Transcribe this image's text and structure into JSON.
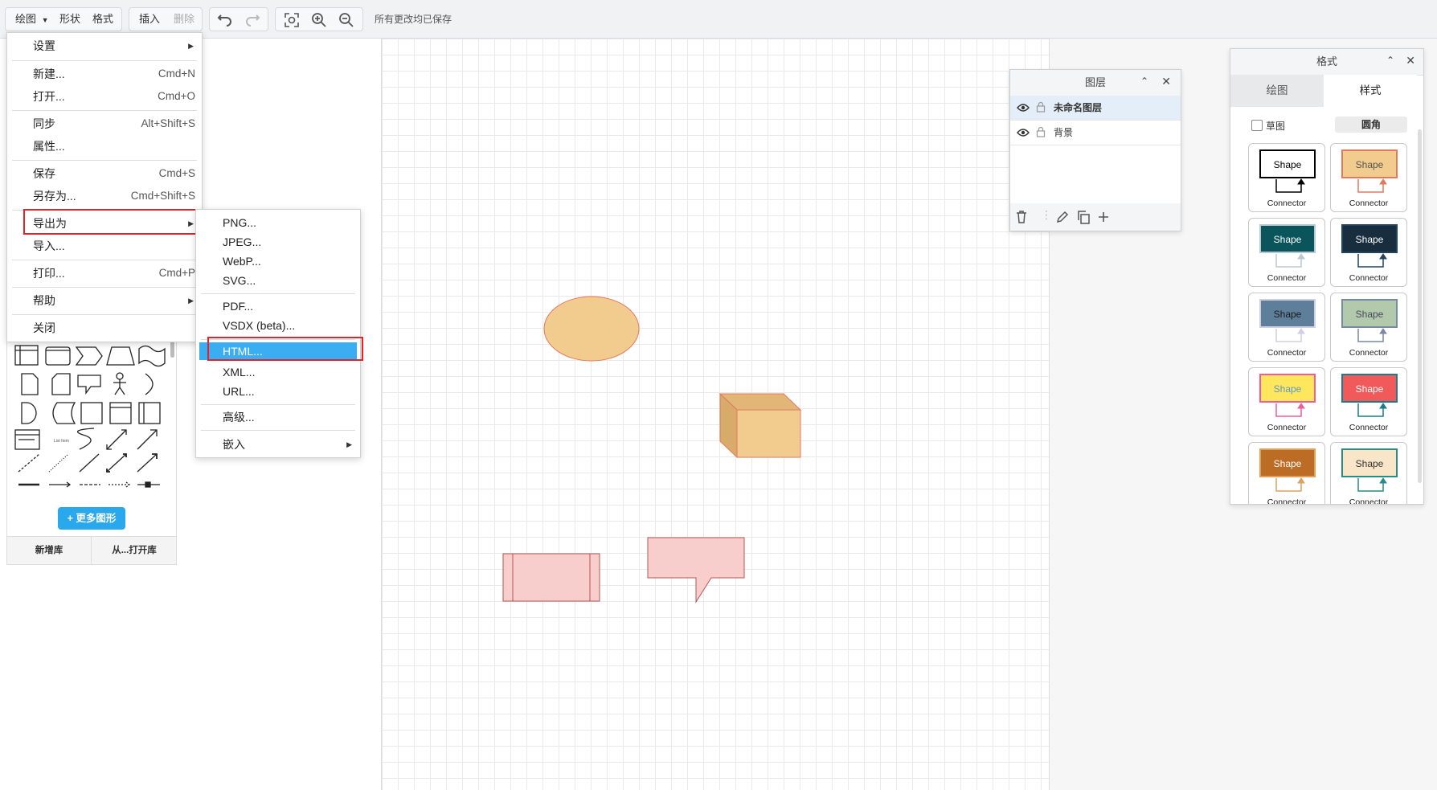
{
  "toolbar": {
    "draw_menu": "绘图",
    "shape_menu": "形状",
    "format_menu": "格式",
    "insert": "插入",
    "delete": "删除",
    "status": "所有更改均已保存"
  },
  "draw_menu": {
    "items": [
      {
        "label": "设置",
        "shortcut": ""
      },
      {
        "label": "新建...",
        "shortcut": "Cmd+N"
      },
      {
        "label": "打开...",
        "shortcut": "Cmd+O"
      },
      {
        "label": "同步",
        "shortcut": "Alt+Shift+S"
      },
      {
        "label": "属性...",
        "shortcut": ""
      },
      {
        "label": "保存",
        "shortcut": "Cmd+S"
      },
      {
        "label": "另存为...",
        "shortcut": "Cmd+Shift+S"
      },
      {
        "label": "导出为",
        "shortcut": ""
      },
      {
        "label": "导入...",
        "shortcut": ""
      },
      {
        "label": "打印...",
        "shortcut": "Cmd+P"
      },
      {
        "label": "帮助",
        "shortcut": ""
      },
      {
        "label": "关闭",
        "shortcut": ""
      }
    ]
  },
  "export_menu": {
    "items": [
      "PNG...",
      "JPEG...",
      "WebP...",
      "SVG...",
      "PDF...",
      "VSDX (beta)...",
      "HTML...",
      "XML...",
      "URL...",
      "高级...",
      "嵌入"
    ],
    "selected": "HTML..."
  },
  "sidebar": {
    "list_item_label": "List Item",
    "more_shapes": "+ 更多图形",
    "new_library": "新增库",
    "open_library": "从...打开库"
  },
  "layers": {
    "title": "图层",
    "rows": [
      "未命名图层",
      "背景"
    ]
  },
  "format": {
    "title": "格式",
    "tabs": [
      "绘图",
      "样式"
    ],
    "sketch": "草图",
    "rounded": "圆角",
    "styles": [
      {
        "shape": "Shape",
        "connector": "Connector",
        "fill": "#ffffff",
        "stroke": "#000000",
        "text": "#000000"
      },
      {
        "shape": "Shape",
        "connector": "Connector",
        "fill": "#f2cc8f",
        "stroke": "#e07a5f",
        "text": "#555555"
      },
      {
        "shape": "Shape",
        "connector": "Connector",
        "fill": "#09555b",
        "stroke": "#bac8d3",
        "text": "#ffffff"
      },
      {
        "shape": "Shape",
        "connector": "Connector",
        "fill": "#182e3e",
        "stroke": "#23445d",
        "text": "#ffffff"
      },
      {
        "shape": "Shape",
        "connector": "Connector",
        "fill": "#5d7f99",
        "stroke": "#d0cee2",
        "text": "#1a1a1a"
      },
      {
        "shape": "Shape",
        "connector": "Connector",
        "fill": "#b2c9ab",
        "stroke": "#788aa3",
        "text": "#46495d"
      },
      {
        "shape": "Shape",
        "connector": "Connector",
        "fill": "#fee75c",
        "stroke": "#f05a9e",
        "text": "#5c98c9"
      },
      {
        "shape": "Shape",
        "connector": "Connector",
        "fill": "#f15a5a",
        "stroke": "#177d8a",
        "text": "#ffffff"
      },
      {
        "shape": "Shape",
        "connector": "Connector",
        "fill": "#bc6c25",
        "stroke": "#dda15e",
        "text": "#ffffff"
      },
      {
        "shape": "Shape",
        "connector": "Connector",
        "fill": "#f9e6c8",
        "stroke": "#2a8a86",
        "text": "#333333"
      }
    ]
  },
  "colors": {
    "accent": "#29a8ee",
    "highlight_red": "#e0242b",
    "selected_item": "#3aaef0",
    "shape_orange_fill": "#f2cc8f",
    "shape_orange_stroke": "#e07a5f",
    "shape_pink_fill": "#f8cecc",
    "shape_pink_stroke": "#b85450"
  }
}
